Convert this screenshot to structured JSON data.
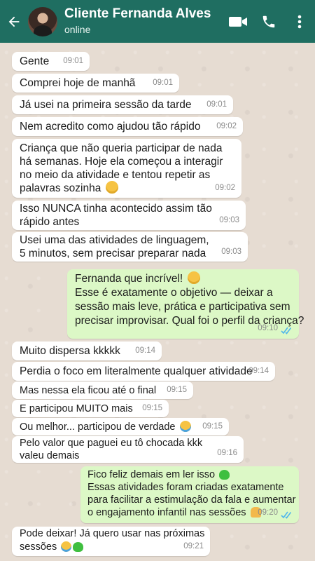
{
  "header": {
    "contact_name": "Cliente Fernanda Alves",
    "status": "online",
    "icons": [
      "back-arrow-icon",
      "video-call-icon",
      "phone-icon",
      "more-vert-icon"
    ],
    "color": "#1f6e61"
  },
  "colors": {
    "incoming": "#ffffff",
    "outgoing": "#dcf8c6",
    "read_ticks": "#4fb6ec"
  },
  "messages": [
    {
      "dir": "in",
      "lines": [
        "Gente"
      ],
      "time": "09:01"
    },
    {
      "dir": "in",
      "lines": [
        "Comprei hoje de manhã"
      ],
      "time": "09:01"
    },
    {
      "dir": "in",
      "lines": [
        "Já usei na primeira sessão da tarde"
      ],
      "time": "09:01"
    },
    {
      "dir": "in",
      "lines": [
        "Nem acredito como ajudou tão rápido"
      ],
      "time": "09:02"
    },
    {
      "dir": "in",
      "lines": [
        "Criança que não queria participar de nada",
        "há semanas. Hoje ela começou a interagir",
        "no meio da atividade e tentou repetir as",
        "palavras sozinha"
      ],
      "emoji": "pleading-face-emoji",
      "time": "09:02"
    },
    {
      "dir": "in",
      "lines": [
        "Isso NUNCA tinha acontecido assim tão",
        "rápido antes"
      ],
      "time": "09:03"
    },
    {
      "dir": "in",
      "lines": [
        "Usei uma das atividades de linguagem,",
        "5 minutos, sem precisar preparar nada"
      ],
      "time": "09:03"
    },
    {
      "dir": "out",
      "lines": [
        "Fernanda que incrível!",
        "Esse é exatamente o objetivo — deixar a",
        "sessão mais leve, prática e participativa sem",
        "precisar improvisar. Qual foi o perfil da criança?"
      ],
      "emoji": "heart-eyes-emoji",
      "time": "09:10"
    },
    {
      "dir": "in",
      "lines": [
        "Muito dispersa kkkkk"
      ],
      "time": "09:14"
    },
    {
      "dir": "in",
      "lines": [
        "Perdia o foco em literalmente qualquer atividade"
      ],
      "time": "09:14"
    },
    {
      "dir": "in",
      "lines": [
        "Mas nessa ela ficou até o final"
      ],
      "time": "09:15"
    },
    {
      "dir": "in",
      "lines": [
        "E participou MUITO mais"
      ],
      "time": "09:15"
    },
    {
      "dir": "in",
      "lines": [
        "Ou melhor... participou de verdade"
      ],
      "emoji": "joy-emoji",
      "time": "09:15"
    },
    {
      "dir": "in",
      "lines": [
        "Pelo valor que paguei eu tô chocada kkk",
        "valeu demais"
      ],
      "time": "09:16"
    },
    {
      "dir": "out",
      "lines": [
        "Fico feliz demais em ler isso",
        "Essas atividades foram criadas exatamente",
        "para facilitar a estimulação da fala e aumentar",
        "o engajamento infantil nas sessões"
      ],
      "emoji": "green-heart-emoji",
      "emoji2": "folded-hands-emoji",
      "time": "09:20"
    },
    {
      "dir": "in",
      "lines": [
        "Pode deixar! Já quero usar nas próximas",
        "sessões"
      ],
      "emoji": "joy-emoji",
      "emoji2": "green-heart-emoji",
      "time": "09:21"
    }
  ]
}
